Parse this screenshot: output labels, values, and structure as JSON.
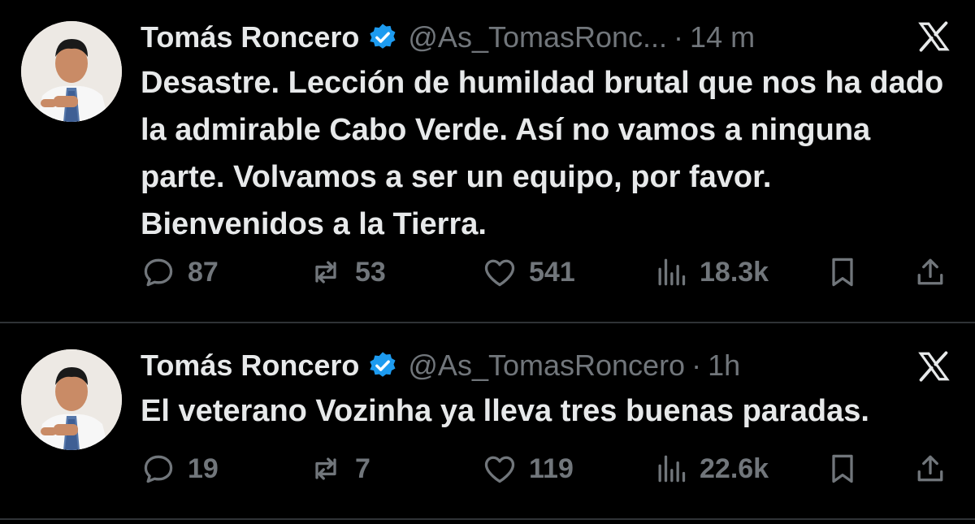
{
  "colors": {
    "background": "#000000",
    "text": "#e7e9ea",
    "muted": "#71767b",
    "verified": "#1d9bf0",
    "divider": "#2f3336"
  },
  "tweets": [
    {
      "author": "Tomás Roncero",
      "handle": "@As_TomasRonc...",
      "separator": "·",
      "time": "14 m",
      "text": "Desastre. Lección de humildad brutal que nos ha dado la admirable Cabo Verde. Así no vamos a ninguna parte. Volvamos a ser un equipo, por favor. Bienvenidos a la Tierra.",
      "replies": "87",
      "reposts": "53",
      "likes": "541",
      "views": "18.3k",
      "icons": [
        "verified-badge-icon",
        "x-logo-icon",
        "reply-icon",
        "repost-icon",
        "like-icon",
        "views-icon",
        "bookmark-icon",
        "share-icon"
      ]
    },
    {
      "author": "Tomás Roncero",
      "handle": "@As_TomasRoncero",
      "separator": "·",
      "time": "1h",
      "text": "El veterano Vozinha ya lleva tres buenas paradas.",
      "replies": "19",
      "reposts": "7",
      "likes": "119",
      "views": "22.6k",
      "icons": [
        "verified-badge-icon",
        "x-logo-icon",
        "reply-icon",
        "repost-icon",
        "like-icon",
        "views-icon",
        "bookmark-icon",
        "share-icon"
      ]
    }
  ]
}
